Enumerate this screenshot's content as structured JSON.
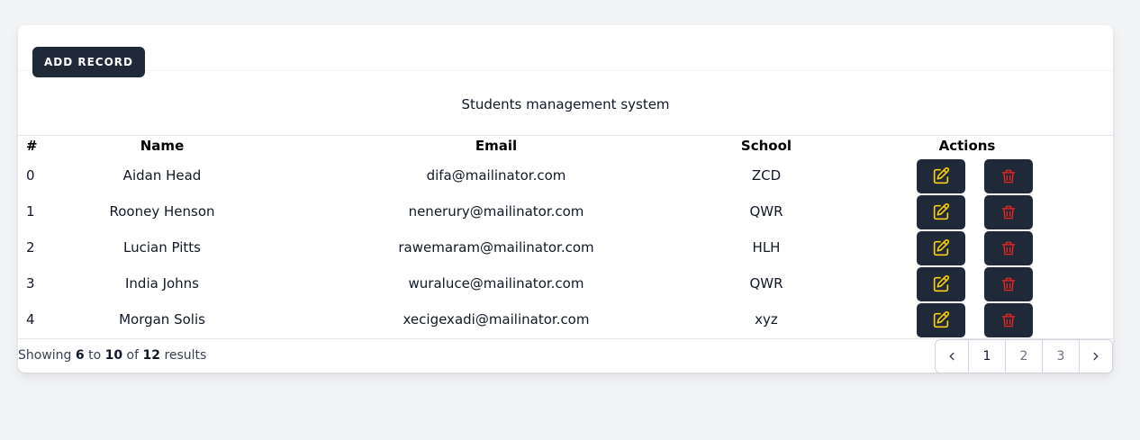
{
  "toolbar": {
    "add_label": "ADD RECORD"
  },
  "caption": "Students management system",
  "columns": {
    "hash": "#",
    "name": "Name",
    "email": "Email",
    "school": "School",
    "actions": "Actions"
  },
  "rows": [
    {
      "index": "0",
      "name": "Aidan Head",
      "email": "difa@mailinator.com",
      "school": "ZCD"
    },
    {
      "index": "1",
      "name": "Rooney Henson",
      "email": "nenerury@mailinator.com",
      "school": "QWR"
    },
    {
      "index": "2",
      "name": "Lucian Pitts",
      "email": "rawemaram@mailinator.com",
      "school": "HLH"
    },
    {
      "index": "3",
      "name": "India Johns",
      "email": "wuraluce@mailinator.com",
      "school": "QWR"
    },
    {
      "index": "4",
      "name": "Morgan Solis",
      "email": "xecigexadi@mailinator.com",
      "school": "xyz"
    }
  ],
  "icons": {
    "edit": "edit-icon",
    "delete": "trash-icon",
    "prev": "chevron-left-icon",
    "next": "chevron-right-icon"
  },
  "colors": {
    "button_bg": "#1f2937",
    "edit_icon": "#facc15",
    "delete_icon": "#dc2626",
    "page_bg": "#f3f4f6"
  },
  "pagination": {
    "summary": {
      "prefix": "Showing",
      "from": "6",
      "to_word": "to",
      "to": "10",
      "of_word": "of",
      "total": "12",
      "suffix": "results"
    },
    "pages": [
      "1",
      "2",
      "3"
    ],
    "current": "1"
  }
}
